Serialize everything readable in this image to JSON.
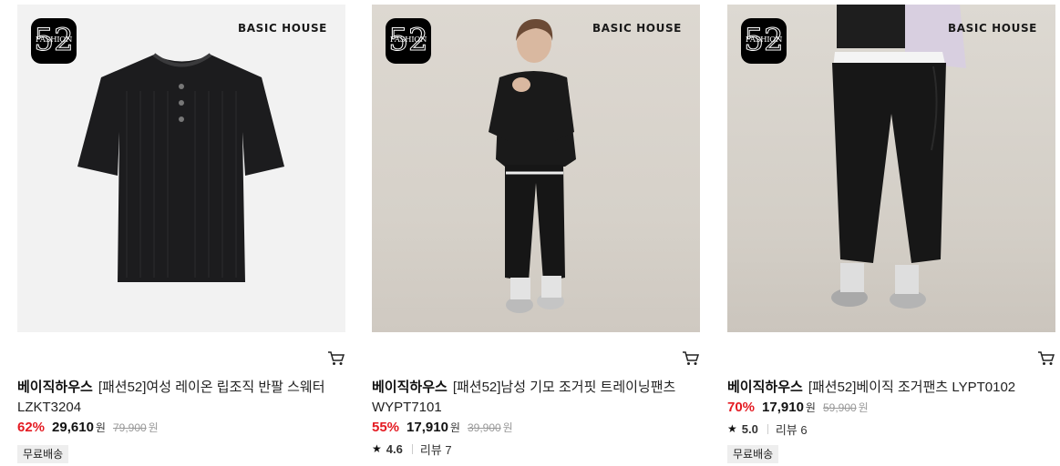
{
  "products": [
    {
      "brand": "베이직하우스",
      "title": "[패션52]여성 레이온 립조직 반팔 스웨터 LZKT3204",
      "discount": "62%",
      "price": "29,610",
      "currency": "원",
      "original_price": "79,900",
      "original_currency": "원",
      "badge": "무료배송",
      "image_logo_number": "52",
      "image_logo_word": "FASHION",
      "image_brand_mark": "BASIC HOUSE"
    },
    {
      "brand": "베이직하우스",
      "title": "[패션52]남성 기모 조거핏 트레이닝팬츠 WYPT7101",
      "discount": "55%",
      "price": "17,910",
      "currency": "원",
      "original_price": "39,900",
      "original_currency": "원",
      "rating": "4.6",
      "review_label": "리뷰 7",
      "image_logo_number": "52",
      "image_logo_word": "FASHION",
      "image_brand_mark": "BASIC HOUSE"
    },
    {
      "brand": "베이직하우스",
      "title": "[패션52]베이직 조거팬츠 LYPT0102",
      "discount": "70%",
      "price": "17,910",
      "currency": "원",
      "original_price": "59,900",
      "original_currency": "원",
      "rating": "5.0",
      "review_label": "리뷰 6",
      "badge": "무료배송",
      "image_logo_number": "52",
      "image_logo_word": "FASHION",
      "image_brand_mark": "BASIC HOUSE"
    }
  ],
  "colors": {
    "discount": "#e41b23",
    "badge_bg": "#eeeeee",
    "strike": "#999999"
  }
}
